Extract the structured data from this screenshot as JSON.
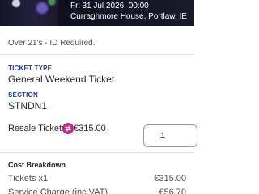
{
  "event": {
    "date_time": "Fri 31 Jul 2026, 00:00",
    "venue": "Curraghmore House, Portlaw, IE"
  },
  "notice": "Over 21's - ID Required.",
  "ticket": {
    "type_label": "TICKET TYPE",
    "type_value": "General Weekend Ticket",
    "section_label": "SECTION",
    "section_value": "STNDN1"
  },
  "resale": {
    "label": "Resale Tickets",
    "icon": "resale-exchange-icon",
    "price": "€315.00",
    "quantity": "1"
  },
  "cost": {
    "title": "Cost Breakdown",
    "rows": [
      {
        "label": "Tickets  x1",
        "amount": "€315.00"
      },
      {
        "label": "Service Charge (inc VAT)",
        "amount": "€56.70"
      }
    ]
  },
  "colors": {
    "accent": "#1f3d99",
    "resale_badge": "#c4288d",
    "text": "#262626"
  }
}
